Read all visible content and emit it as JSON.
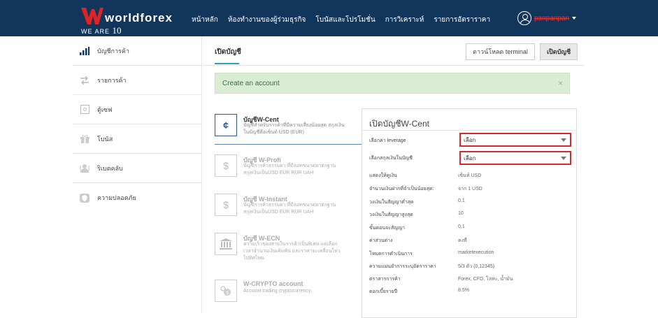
{
  "header": {
    "logo_text": "worldforex",
    "logo_sub": "WE ARE",
    "logo_num": "10",
    "nav": [
      "หน้าหลัก",
      "ห้องทำงานของผู้ร่วมธุรกิจ",
      "โบนัสและโปรโมชั่น",
      "การวิเคราะห์",
      "รายการอัตราราคา"
    ],
    "user_name": "panpanpan"
  },
  "sidebar": {
    "items": [
      {
        "label": "บัญชีการค้า",
        "icon": "bar-chart-icon"
      },
      {
        "label": "รายการค้า",
        "icon": "transfer-arrows-icon"
      },
      {
        "label": "ตู้เซฟ",
        "icon": "safe-icon"
      },
      {
        "label": "โบนัส",
        "icon": "gift-icon"
      },
      {
        "label": "ริเบตคลับ",
        "icon": "rebate-club-icon"
      },
      {
        "label": "ความปลอดภัย",
        "icon": "shield-icon"
      }
    ]
  },
  "main": {
    "tab": "เปิดบัญชี",
    "download_button": "ดาวน์โหลด terminal",
    "open_button": "เปิดบัญชี",
    "alert": "Create an account",
    "alert_close": "×"
  },
  "accounts": [
    {
      "name": "บัญชีW-Cent",
      "desc": "บัญชีสำหรับการค้าที่มีความเสี่ยงน้อยสุด สกุลเงินในบัญชีคือเซ็นท์ USD (EUR)",
      "icon": "¢"
    },
    {
      "name": "บัญชี W-Profi",
      "desc": "บัญชีการค้าธรรมดา ที่มีลอทขนาดมาตรฐาน สกุลเงินเป็นUSD EUR RUR UAH",
      "icon": "$"
    },
    {
      "name": "บัญชี W-Instant",
      "desc": "บัญชีการค้าธรรมดา ที่มีลอทขนาดมาตรฐาน สกุลเงินเป็นUSD EUR RUR UAH",
      "icon": "$"
    },
    {
      "name": "บัญชี W-ECN",
      "desc": "ความเร็วของสายในการค้าเป็นพิเศษ แต่เลือกเวลาจำนวนเงินเดิมพัน และราคาจะเคลื่อนไหวไปทิศไหน",
      "icon": "bank-icon"
    },
    {
      "name": "W-CRYPTO account",
      "desc": "Account trading cryptocurrency.",
      "icon": "crypto-icon"
    }
  ],
  "panel": {
    "title": "เปิดบัญชีW-Cent",
    "leverage_label": "เลือกค่า leverage",
    "leverage_value": "เลือก",
    "currency_label": "เลือกสกุลเงินในบัญชี",
    "currency_value": "เลือก",
    "rows": [
      {
        "label": "แสดงให้ดูเงิน",
        "value": "เซ็นท์ USD"
      },
      {
        "label": "จำนวนเงินฝากที่จำเป็นน้อยสุด:",
        "value": "จาก 1 USD"
      },
      {
        "label": "วงเงินในสัญญาต่ำสุด",
        "value": "0,1"
      },
      {
        "label": "วงเงินในสัญญาสูงสุด",
        "value": "10"
      },
      {
        "label": "ขั้นตอนจะสัญญา",
        "value": "0,1"
      },
      {
        "label": "ค่าส่วนต่าง",
        "value": "คงที่"
      },
      {
        "label": "โหมดการดำเนินการ",
        "value": "marketexecution"
      },
      {
        "label": "ความแม่นยำการระบุอัตราราคา",
        "value": "5/3 ตัว (0,12345)"
      },
      {
        "label": "ตราสารการค้า",
        "value": "Forex, CFD, โลหะ, น้ำมัน"
      },
      {
        "label": "ดอกเบี้ยรายปี",
        "value": "8,5%"
      }
    ]
  },
  "colors": {
    "topbar": "#12355b",
    "accent": "#2aa3b8",
    "highlight": "#d62a2a",
    "alert_bg": "#d9ecd4"
  }
}
